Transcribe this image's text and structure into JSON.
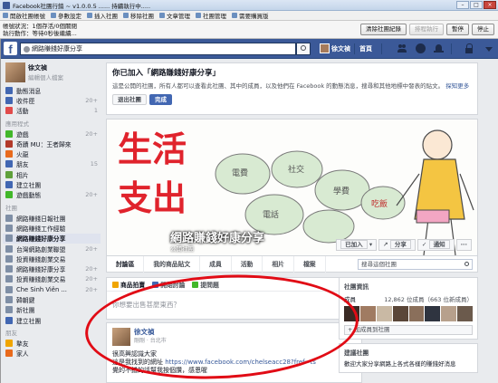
{
  "app": {
    "title": "Facebook社團行銷 ~ v1.0.0.5 ...... 持續執行中.....",
    "menu": [
      "開啟社團帳號",
      "參數設定",
      "插入社團",
      "移除社團",
      "文章管理",
      "社團管理",
      "需要購買版"
    ],
    "status_line1": "帳號狀況：1個存活/0個關閉",
    "status_line2": "執行動作：等待0秒後繼續...",
    "buttons": [
      "清除社團紀錄",
      "排程執行",
      "暫停",
      "停止"
    ]
  },
  "fb": {
    "search_value": "網路賺錢好康分享",
    "user_name": "徐文禎",
    "home_label": "首頁"
  },
  "left": {
    "profile_name": "徐文禎",
    "profile_edit": "編輯個人檔案",
    "items": [
      {
        "label": "動態消息",
        "count": "",
        "color": "#4267b2"
      },
      {
        "label": "收件匣",
        "count": "20+",
        "color": "#4267b2"
      },
      {
        "label": "活動",
        "count": "1",
        "color": "#e14b4b"
      }
    ],
    "apps_header": "應用程式",
    "apps": [
      {
        "label": "遊戲",
        "count": "20+",
        "color": "#42b72a"
      },
      {
        "label": "奇蹟 MU：王者歸來",
        "count": "",
        "color": "#b23a2a"
      },
      {
        "label": "火龍",
        "count": "",
        "color": "#e86a1c"
      },
      {
        "label": "朋友",
        "count": "15",
        "color": "#4267b2"
      },
      {
        "label": "相片",
        "count": "",
        "color": "#5fa03b"
      },
      {
        "label": "建立社團",
        "count": "",
        "color": "#4267b2"
      },
      {
        "label": "遊戲動態",
        "count": "20+",
        "color": "#42b72a"
      }
    ],
    "groups_header": "社團",
    "groups": [
      {
        "label": "網路賺錢日報社團",
        "count": "",
        "color": "#7f8fa6"
      },
      {
        "label": "網路賺錢工作經驗",
        "count": "",
        "color": "#7f8fa6"
      },
      {
        "label": "網路賺錢好康分享",
        "count": "",
        "color": "#7f8fa6",
        "selected": true
      },
      {
        "label": "台灣網路創業聯盟",
        "count": "20+",
        "color": "#7f8fa6"
      },
      {
        "label": "投資賺錢創業交易",
        "count": "",
        "color": "#7f8fa6"
      },
      {
        "label": "網路賺錢好康分享",
        "count": "20+",
        "color": "#7f8fa6"
      },
      {
        "label": "投資賺錢創業交易",
        "count": "20+",
        "color": "#7f8fa6"
      },
      {
        "label": "Che Sinh Viên ...",
        "count": "20+",
        "color": "#7f8fa6"
      },
      {
        "label": "韓朝鍵",
        "count": "",
        "color": "#7f8fa6"
      },
      {
        "label": "新社團",
        "count": "",
        "color": "#7f8fa6"
      },
      {
        "label": "建立社團",
        "count": "",
        "color": "#4267b2"
      }
    ],
    "friends_header": "朋友",
    "friends": [
      {
        "label": "摯友",
        "count": "",
        "color": "#f0a500"
      },
      {
        "label": "家人",
        "count": "",
        "color": "#e86a1c"
      }
    ]
  },
  "join": {
    "title": "你已加入「網路賺錢好康分享」",
    "desc": "這是公開的社團，所有人都可以查看此社團、其中的成員，以及他們在 Facebook 的動態消息，搜尋和其他地標中發表的貼文。",
    "more": "探知更多",
    "leave": "退出社團",
    "done": "完成"
  },
  "cover": {
    "big1": "生活",
    "big2": "支出",
    "pig_labels": [
      "電費",
      "社交",
      "學費",
      "吃飯",
      "電話"
    ],
    "group_name": "網路賺錢好康分享",
    "group_type": "公開社團",
    "joined": "已加入",
    "share": "分享",
    "notify": "通知"
  },
  "tabs": {
    "items": [
      "討論區",
      "我的商品貼文",
      "成員",
      "活動",
      "相片",
      "檔案"
    ],
    "search_placeholder": "搜尋這個社團"
  },
  "composer": {
    "tabs": [
      "商品拍賣",
      "開始討論",
      "提問題"
    ],
    "placeholder": "你想要出售甚麼東西？"
  },
  "post": {
    "author": "徐文禎",
    "meta": "剛剛 · 台北市",
    "line1": "很高興認識大家",
    "line2_prefix": "這是我找到的網址 ",
    "line2_link": "https://www.facebook.com/chelseacc28?fref=ts",
    "line3": "覺的不錯的話幫我按個讚，感恩喔"
  },
  "right": {
    "members_header": "社團資訊",
    "members_label": "成員",
    "members_count": "12,862 位成員（663 位新成員）",
    "add_members": "+ 加成員到社團",
    "suggest_header": "建議社團",
    "suggest_text": "歡迎大家分享網路上各式各樣的賺錢好消息"
  },
  "colors": {
    "fb_blue": "#3b5998",
    "annotation_red": "#e10b15"
  }
}
